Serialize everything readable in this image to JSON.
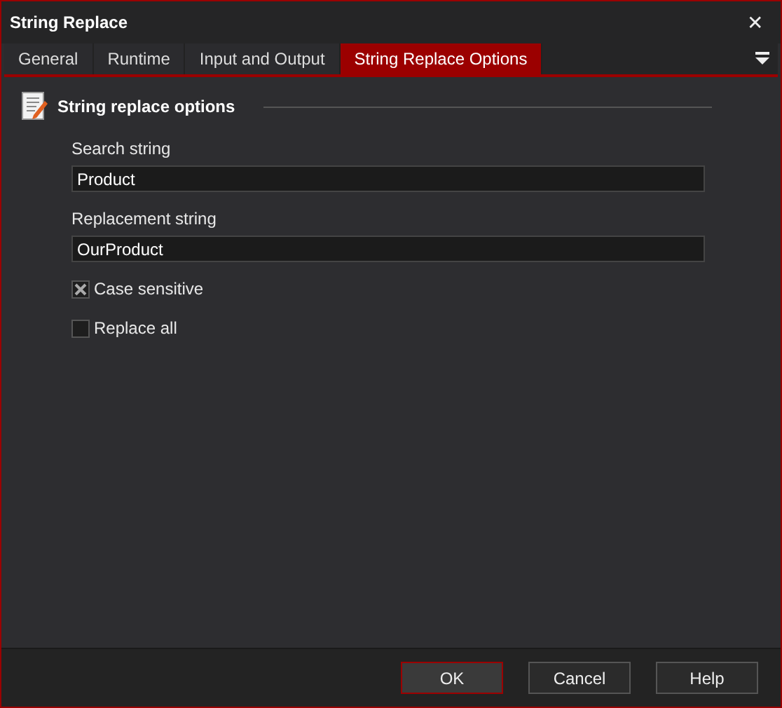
{
  "window": {
    "title": "String Replace",
    "close": "✕"
  },
  "tabs": [
    {
      "label": "General",
      "selected": false
    },
    {
      "label": "Runtime",
      "selected": false
    },
    {
      "label": "Input and Output",
      "selected": false
    },
    {
      "label": "String Replace Options",
      "selected": true
    }
  ],
  "section": {
    "title": "String replace options"
  },
  "fields": [
    {
      "label": "Search string",
      "value": "Product"
    },
    {
      "label": "Replacement string",
      "value": "OurProduct"
    }
  ],
  "checkboxes": [
    {
      "label": "Case sensitive",
      "checked": true
    },
    {
      "label": "Replace all",
      "checked": false
    }
  ],
  "buttons": [
    {
      "label": "OK",
      "default": true
    },
    {
      "label": "Cancel",
      "default": false
    },
    {
      "label": "Help",
      "default": false
    }
  ]
}
